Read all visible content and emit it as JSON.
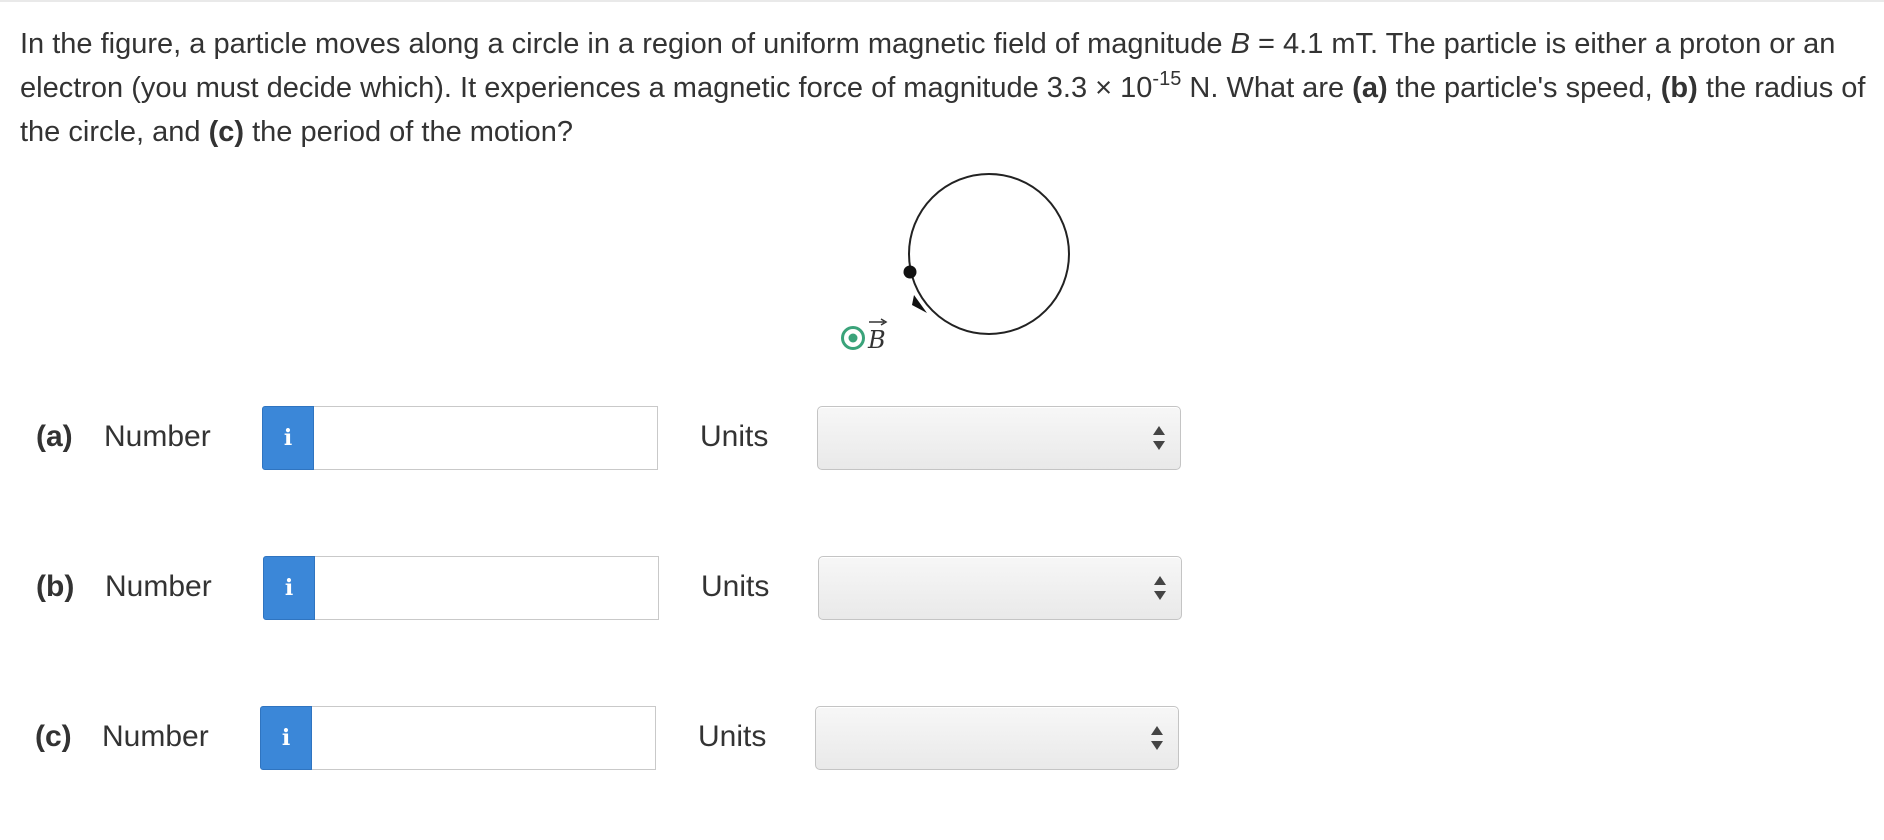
{
  "question": {
    "part1": "In the figure, a particle moves along a circle in a region of uniform magnetic field of magnitude ",
    "b_symbol": "B",
    "part2": " = 4.1 mT. The particle is either a proton or an electron (you must decide which). It experiences a magnetic force of magnitude 3.3 × 10",
    "exponent": "-15",
    "part3": " N. What are ",
    "label_a": "(a)",
    "part4": " the particle's speed, ",
    "label_b": "(b)",
    "part5": " the radius of the circle, and ",
    "label_c": "(c)",
    "part6": " the period of the motion?"
  },
  "figure": {
    "field_label": "B",
    "field_symbol": "field-out-of-page-icon"
  },
  "answers": [
    {
      "part": "(a)",
      "number_label": "Number",
      "info_icon": "i",
      "value": "",
      "units_label": "Units",
      "units_value": ""
    },
    {
      "part": "(b)",
      "number_label": "Number",
      "info_icon": "i",
      "value": "",
      "units_label": "Units",
      "units_value": ""
    },
    {
      "part": "(c)",
      "number_label": "Number",
      "info_icon": "i",
      "value": "",
      "units_label": "Units",
      "units_value": ""
    }
  ],
  "colors": {
    "info_button": "#3b87d8",
    "field_symbol": "#3aa37a",
    "text": "#333333"
  }
}
